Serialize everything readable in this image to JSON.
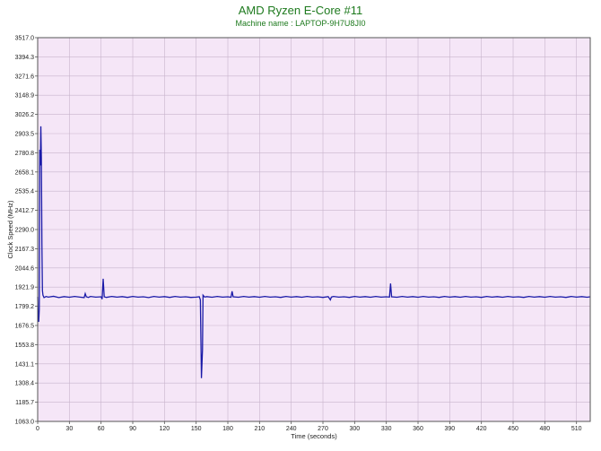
{
  "chart_data": {
    "type": "line",
    "title": "AMD Ryzen E-Core #11",
    "subtitle": "Machine name : LAPTOP-9H7U8JI0",
    "xlabel": "Time (seconds)",
    "ylabel": "Clock Speed (MHz)",
    "xlim": [
      0,
      523
    ],
    "ylim": [
      1063.0,
      3517.0
    ],
    "x_ticks": [
      0,
      30,
      60,
      90,
      120,
      150,
      180,
      210,
      240,
      270,
      300,
      330,
      360,
      390,
      420,
      450,
      480,
      510
    ],
    "y_ticks": [
      "1063.0",
      "1185.7",
      "1308.4",
      "1431.1",
      "1553.8",
      "1676.5",
      "1799.2",
      "1921.9",
      "2044.6",
      "2167.3",
      "2290.0",
      "2412.7",
      "2535.4",
      "2658.1",
      "2780.8",
      "2903.5",
      "3026.2",
      "3148.9",
      "3271.6",
      "3394.3",
      "3517.0"
    ],
    "grid": true,
    "colors": {
      "plot_background": "#f5e6f7",
      "grid": "#c8b4cc",
      "line": "#1a1aa8",
      "title": "#1e7a1e"
    },
    "series": [
      {
        "points": [
          [
            0,
            1860
          ],
          [
            0.5,
            1720
          ],
          [
            1,
            1700
          ],
          [
            1.5,
            1780
          ],
          [
            2,
            2800
          ],
          [
            2.5,
            2700
          ],
          [
            3,
            2950
          ],
          [
            3.5,
            2750
          ],
          [
            4,
            2200
          ],
          [
            4.5,
            1900
          ],
          [
            5,
            1870
          ],
          [
            6,
            1855
          ],
          [
            8,
            1862
          ],
          [
            10,
            1858
          ],
          [
            15,
            1863
          ],
          [
            20,
            1855
          ],
          [
            25,
            1861
          ],
          [
            30,
            1857
          ],
          [
            35,
            1862
          ],
          [
            40,
            1858
          ],
          [
            44,
            1855
          ],
          [
            45,
            1880
          ],
          [
            46,
            1860
          ],
          [
            48,
            1856
          ],
          [
            50,
            1862
          ],
          [
            55,
            1858
          ],
          [
            60,
            1860
          ],
          [
            61,
            1845
          ],
          [
            62,
            1975
          ],
          [
            63,
            1860
          ],
          [
            65,
            1856
          ],
          [
            70,
            1862
          ],
          [
            75,
            1858
          ],
          [
            80,
            1861
          ],
          [
            85,
            1856
          ],
          [
            90,
            1862
          ],
          [
            95,
            1858
          ],
          [
            100,
            1860
          ],
          [
            105,
            1855
          ],
          [
            110,
            1862
          ],
          [
            115,
            1858
          ],
          [
            120,
            1861
          ],
          [
            125,
            1856
          ],
          [
            130,
            1862
          ],
          [
            135,
            1858
          ],
          [
            140,
            1860
          ],
          [
            145,
            1856
          ],
          [
            150,
            1858
          ],
          [
            153,
            1860
          ],
          [
            154,
            1840
          ],
          [
            155,
            1340
          ],
          [
            156,
            1520
          ],
          [
            156.5,
            1870
          ],
          [
            158,
            1858
          ],
          [
            160,
            1861
          ],
          [
            165,
            1857
          ],
          [
            170,
            1862
          ],
          [
            175,
            1858
          ],
          [
            180,
            1860
          ],
          [
            183,
            1857
          ],
          [
            184,
            1895
          ],
          [
            185,
            1860
          ],
          [
            190,
            1857
          ],
          [
            195,
            1862
          ],
          [
            200,
            1858
          ],
          [
            205,
            1861
          ],
          [
            210,
            1857
          ],
          [
            215,
            1862
          ],
          [
            220,
            1858
          ],
          [
            225,
            1860
          ],
          [
            230,
            1856
          ],
          [
            235,
            1862
          ],
          [
            240,
            1858
          ],
          [
            245,
            1861
          ],
          [
            250,
            1857
          ],
          [
            255,
            1862
          ],
          [
            260,
            1858
          ],
          [
            265,
            1860
          ],
          [
            270,
            1856
          ],
          [
            275,
            1861
          ],
          [
            277,
            1840
          ],
          [
            278,
            1858
          ],
          [
            280,
            1862
          ],
          [
            285,
            1858
          ],
          [
            290,
            1860
          ],
          [
            295,
            1856
          ],
          [
            300,
            1862
          ],
          [
            305,
            1858
          ],
          [
            310,
            1861
          ],
          [
            315,
            1857
          ],
          [
            320,
            1862
          ],
          [
            325,
            1858
          ],
          [
            330,
            1860
          ],
          [
            333,
            1858
          ],
          [
            334,
            1945
          ],
          [
            335,
            1860
          ],
          [
            340,
            1857
          ],
          [
            345,
            1862
          ],
          [
            350,
            1858
          ],
          [
            355,
            1861
          ],
          [
            360,
            1857
          ],
          [
            365,
            1862
          ],
          [
            370,
            1858
          ],
          [
            375,
            1860
          ],
          [
            380,
            1856
          ],
          [
            385,
            1862
          ],
          [
            390,
            1858
          ],
          [
            395,
            1861
          ],
          [
            400,
            1857
          ],
          [
            405,
            1862
          ],
          [
            410,
            1858
          ],
          [
            415,
            1860
          ],
          [
            420,
            1856
          ],
          [
            425,
            1862
          ],
          [
            430,
            1858
          ],
          [
            435,
            1861
          ],
          [
            440,
            1857
          ],
          [
            445,
            1862
          ],
          [
            450,
            1858
          ],
          [
            455,
            1860
          ],
          [
            460,
            1856
          ],
          [
            465,
            1862
          ],
          [
            470,
            1858
          ],
          [
            475,
            1861
          ],
          [
            480,
            1857
          ],
          [
            485,
            1862
          ],
          [
            490,
            1858
          ],
          [
            495,
            1860
          ],
          [
            500,
            1856
          ],
          [
            505,
            1862
          ],
          [
            510,
            1858
          ],
          [
            515,
            1861
          ],
          [
            520,
            1857
          ],
          [
            523,
            1860
          ]
        ]
      }
    ]
  }
}
